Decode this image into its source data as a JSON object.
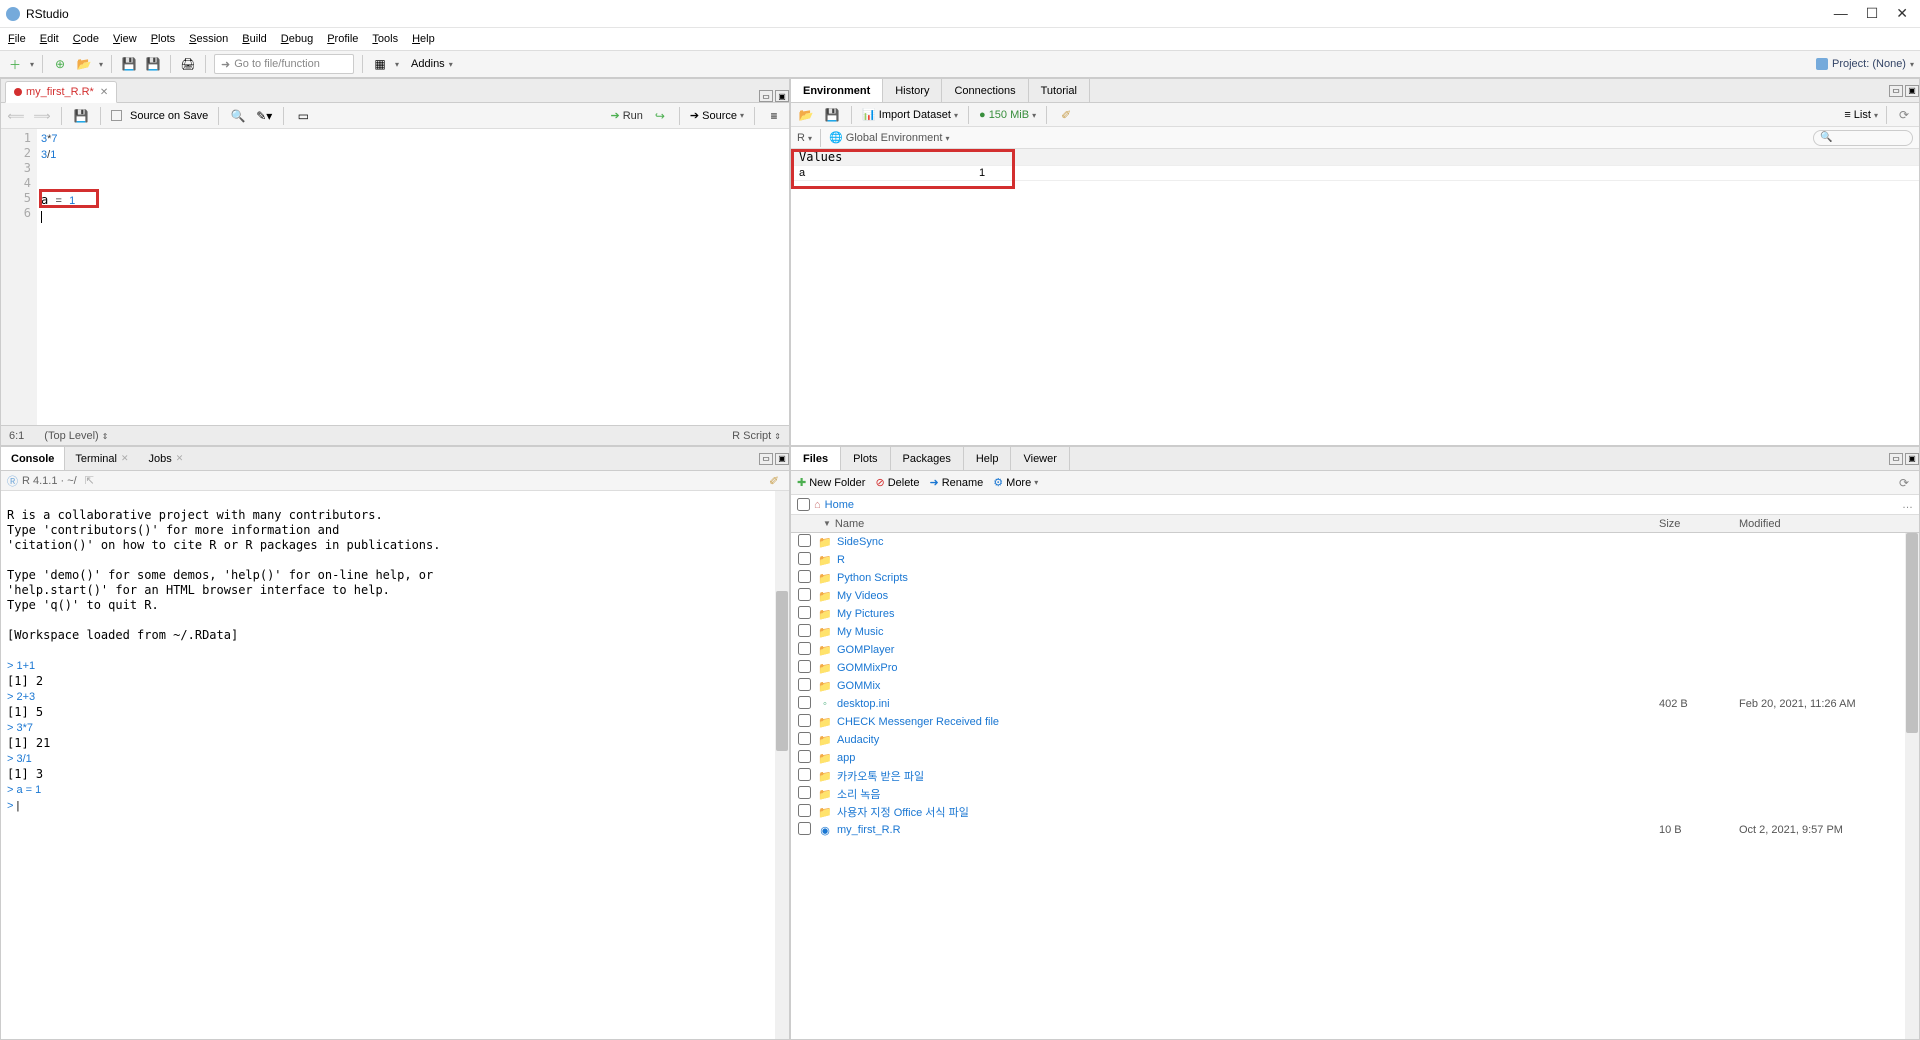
{
  "app": {
    "title": "RStudio"
  },
  "menu": [
    "File",
    "Edit",
    "Code",
    "View",
    "Plots",
    "Session",
    "Build",
    "Debug",
    "Profile",
    "Tools",
    "Help"
  ],
  "toolbar": {
    "goto_placeholder": "Go to file/function",
    "addins": "Addins",
    "project": "Project: (None)"
  },
  "source": {
    "tab": "my_first_R.R*",
    "sourceonsave": "Source on Save",
    "run": "Run",
    "source_btn": "Source",
    "lines": [
      "3*7",
      "3/1",
      "",
      "",
      "a = 1",
      ""
    ],
    "position": "6:1",
    "scope": "(Top Level)",
    "lang": "R Script"
  },
  "console": {
    "tabs": [
      "Console",
      "Terminal",
      "Jobs"
    ],
    "version": "R 4.1.1 · ~/",
    "text": [
      "",
      "R is a collaborative project with many contributors.",
      "Type 'contributors()' for more information and",
      "'citation()' on how to cite R or R packages in publications.",
      "",
      "Type 'demo()' for some demos, 'help()' for on-line help, or",
      "'help.start()' for an HTML browser interface to help.",
      "Type 'q()' to quit R.",
      "",
      "[Workspace loaded from ~/.RData]",
      ""
    ],
    "history": [
      {
        "in": "1+1",
        "out": "[1] 2"
      },
      {
        "in": "2+3",
        "out": "[1] 5"
      },
      {
        "in": "3*7",
        "out": "[1] 21"
      },
      {
        "in": "3/1",
        "out": "[1] 3"
      },
      {
        "in": "a = 1",
        "out": ""
      }
    ]
  },
  "env": {
    "tabs": [
      "Environment",
      "History",
      "Connections",
      "Tutorial"
    ],
    "import": "Import Dataset",
    "mem": "150 MiB",
    "list": "List",
    "lang": "R",
    "scope": "Global Environment",
    "section": "Values",
    "vars": [
      {
        "name": "a",
        "value": "1"
      }
    ]
  },
  "files": {
    "tabs": [
      "Files",
      "Plots",
      "Packages",
      "Help",
      "Viewer"
    ],
    "btns": {
      "newfolder": "New Folder",
      "delete": "Delete",
      "rename": "Rename",
      "more": "More"
    },
    "home": "Home",
    "cols": {
      "name": "Name",
      "size": "Size",
      "mod": "Modified"
    },
    "rows": [
      {
        "t": "folder",
        "n": "SideSync"
      },
      {
        "t": "folder",
        "n": "R"
      },
      {
        "t": "folder",
        "n": "Python Scripts"
      },
      {
        "t": "folder",
        "n": "My Videos"
      },
      {
        "t": "folder",
        "n": "My Pictures"
      },
      {
        "t": "folder",
        "n": "My Music"
      },
      {
        "t": "folder",
        "n": "GOMPlayer"
      },
      {
        "t": "folder",
        "n": "GOMMixPro"
      },
      {
        "t": "folder",
        "n": "GOMMix"
      },
      {
        "t": "file",
        "n": "desktop.ini",
        "s": "402 B",
        "m": "Feb 20, 2021, 11:26 AM"
      },
      {
        "t": "folder",
        "n": "CHECK Messenger Received file"
      },
      {
        "t": "folder",
        "n": "Audacity"
      },
      {
        "t": "folder",
        "n": "app"
      },
      {
        "t": "folder",
        "n": "카카오톡 받은 파일"
      },
      {
        "t": "folder",
        "n": "소리 녹음"
      },
      {
        "t": "folder",
        "n": "사용자 지정 Office 서식 파일"
      },
      {
        "t": "r",
        "n": "my_first_R.R",
        "s": "10 B",
        "m": "Oct 2, 2021, 9:57 PM"
      }
    ]
  }
}
